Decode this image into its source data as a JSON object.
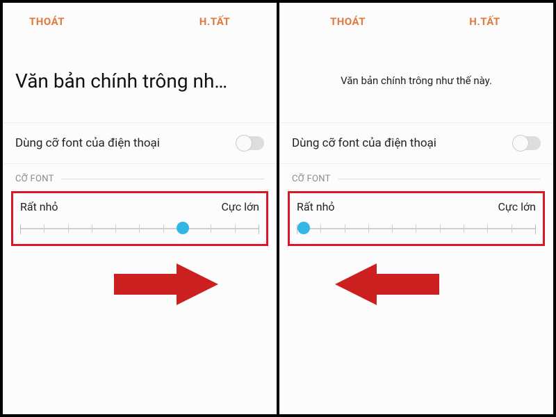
{
  "colors": {
    "accent_text": "#e07a3f",
    "highlight_box": "#d7172a",
    "slider_thumb": "#33b5e5",
    "arrow": "#cc1f1f"
  },
  "toolbar": {
    "exit_label": "THOÁT",
    "done_label": "H.TẤT"
  },
  "left": {
    "preview_text": "Văn bản chính trông nh…",
    "toggle_label": "Dùng cỡ font của điện thoại",
    "section_title": "CỠ FONT",
    "slider_min_label": "Rất nhỏ",
    "slider_max_label": "Cực lớn",
    "slider_position_percent": 68
  },
  "right": {
    "preview_text": "Văn bản chính trông như thế này.",
    "toggle_label": "Dùng cỡ font của điện thoại",
    "section_title": "CỠ FONT",
    "slider_min_label": "Rất nhỏ",
    "slider_max_label": "Cực lớn",
    "slider_position_percent": 3
  }
}
